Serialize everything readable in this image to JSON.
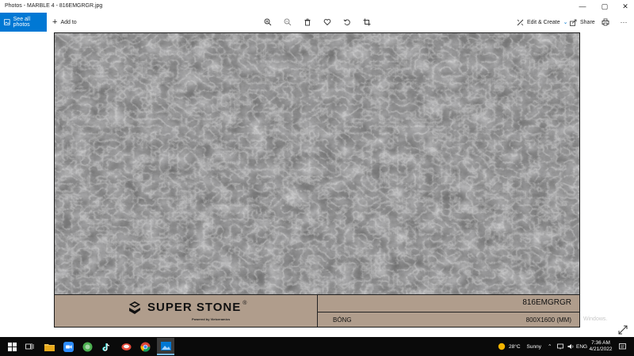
{
  "window": {
    "title": "Photos - MARBLE 4 - 816EMGRGR.jpg",
    "controls": {
      "minimize": "—",
      "maximize": "▢",
      "close": "✕"
    }
  },
  "toolbar": {
    "see_all_photos": "See all photos",
    "add_to": "Add to",
    "edit_create": "Edit & Create",
    "share": "Share",
    "icons": [
      "zoom-in-icon",
      "zoom-out-icon",
      "delete-icon",
      "favorite-icon",
      "rotate-icon",
      "crop-icon",
      "print-icon",
      "more-icon"
    ]
  },
  "photo": {
    "brand": "SUPER STONE",
    "brand_mark": "®",
    "brand_subtitle": "Powered by Vietceramics",
    "product_code": "816EMGRGR",
    "finish": "BÓNG",
    "dimensions": "800X1600 (MM)"
  },
  "watermark": "Windows.",
  "taskbar": {
    "weather_temp": "28°C",
    "weather_desc": "Sunny",
    "language": "ENG",
    "time": "7:36 AM",
    "date": "4/21/2022"
  },
  "colors": {
    "accent": "#0078d4",
    "label_band": "#b09d8c",
    "marble_base": "#6e6e6e",
    "taskbar": "#0a0a0a"
  }
}
